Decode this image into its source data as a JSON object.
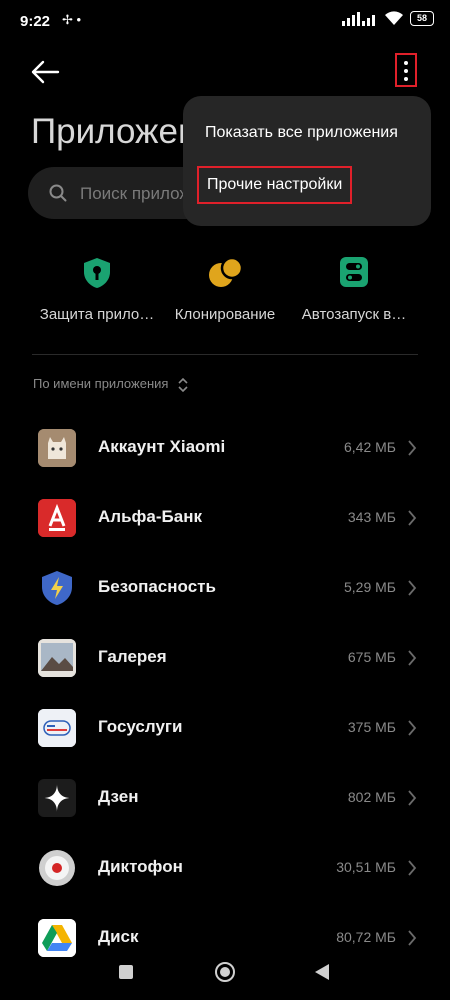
{
  "status_bar": {
    "time": "9:22",
    "left_icons": "✢ •",
    "battery": "58"
  },
  "header": {
    "title": "Приложения",
    "search_placeholder": "Поиск приложений"
  },
  "menu": {
    "items": [
      {
        "label": "Показать все приложения"
      },
      {
        "label": "Прочие настройки"
      }
    ]
  },
  "shortcuts": [
    {
      "label": "Защита прило…",
      "icon": "shield-lock-icon",
      "color": "#1aa371"
    },
    {
      "label": "Клонирование",
      "icon": "clone-icon",
      "color": "#e0a51c"
    },
    {
      "label": "Автозапуск в…",
      "icon": "toggle-icon",
      "color": "#1aa371"
    }
  ],
  "sort": {
    "label": "По имени приложения"
  },
  "apps": [
    {
      "name": "Аккаунт Xiaomi",
      "size": "6,42 МБ",
      "icon": "xiaomi-account-icon"
    },
    {
      "name": "Альфа-Банк",
      "size": "343 МБ",
      "icon": "alfa-bank-icon"
    },
    {
      "name": "Безопасность",
      "size": "5,29 МБ",
      "icon": "security-shield-icon"
    },
    {
      "name": "Галерея",
      "size": "675 МБ",
      "icon": "gallery-icon"
    },
    {
      "name": "Госуслуги",
      "size": "375 МБ",
      "icon": "gosuslugi-icon"
    },
    {
      "name": "Дзен",
      "size": "802 МБ",
      "icon": "dzen-icon"
    },
    {
      "name": "Диктофон",
      "size": "30,51 МБ",
      "icon": "recorder-icon"
    },
    {
      "name": "Диск",
      "size": "80,72 МБ",
      "icon": "drive-icon"
    }
  ],
  "colors": {
    "background": "#000000",
    "menu_bg": "#262626",
    "search_bg": "#1f1f1f",
    "highlight": "#e0202a",
    "accent_green": "#1aa371",
    "accent_gold": "#e0a51c"
  }
}
